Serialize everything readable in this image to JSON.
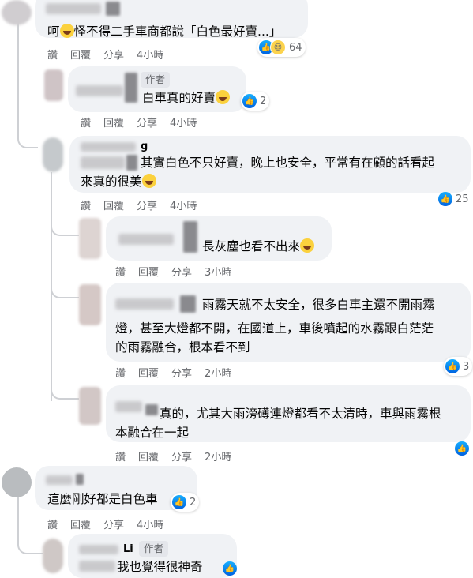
{
  "actions": {
    "like": "讚",
    "reply": "回覆",
    "share": "分享"
  },
  "comments": [
    {
      "text": "呵",
      "text_after_emoji": "怪不得二手車商都說「白色最好賣...」",
      "time": "4小時",
      "reaction_count": "64"
    },
    {
      "author_tag": "作者",
      "text": "白車真的好賣",
      "time": "4小時",
      "reaction_count": "2"
    },
    {
      "name_partial": "g",
      "text_line1": "其實白色不只好賣，晚上也安全，平常有在顧的話看起",
      "text_line2": "來真的很美",
      "time": "4小時",
      "reaction_count": "25"
    },
    {
      "text": "長灰塵也看不出來",
      "time": "3小時"
    },
    {
      "text_line1": "雨霧天就不太安全，很多白車主還不開雨霧",
      "text_line2": "燈，甚至大燈都不開，在國道上，車後噴起的水霧跟白茫茫",
      "text_line3": "的雨霧融合，根本看不到",
      "time": "2小時",
      "reaction_count": "3"
    },
    {
      "text_line1": "真的，尤其大雨滂礡連燈都看不太清時，車與雨霧根",
      "text_line2": "本融合在一起",
      "time": "2小時"
    },
    {
      "text": "這麼剛好都是白色車",
      "time": "4小時",
      "reaction_count": "2"
    },
    {
      "name_partial": "Li",
      "author_tag": "作者",
      "text": "我也覺得很神奇"
    }
  ],
  "colors": {
    "bubble": "#f0f2f5",
    "like_blue": "#1877f2",
    "meta_gray": "#65676b",
    "thread_line": "#ced0d4"
  }
}
